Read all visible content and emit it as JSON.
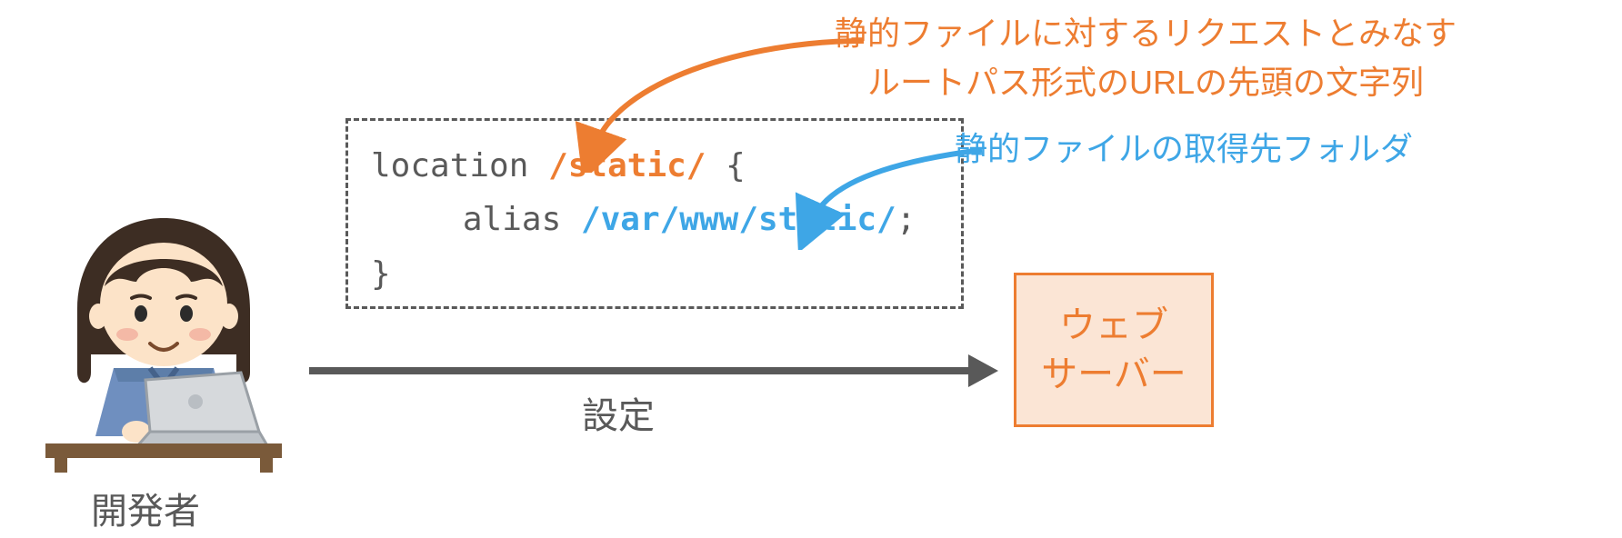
{
  "developer": {
    "label": "開発者"
  },
  "code": {
    "location_keyword": "location",
    "location_path": "/static/",
    "open_brace": "{",
    "alias_keyword": "alias",
    "alias_path": "/var/www/static/",
    "semicolon": ";",
    "close_brace": "}"
  },
  "flow": {
    "label": "設定"
  },
  "server": {
    "line1": "ウェブ",
    "line2": "サーバー"
  },
  "annotation_orange": {
    "line1": "静的ファイルに対するリクエストとみなす",
    "line2": "ルートパス形式のURLの先頭の文字列"
  },
  "annotation_blue": {
    "text": "静的ファイルの取得先フォルダ"
  },
  "colors": {
    "orange": "#ED7D31",
    "blue": "#3EA6E6",
    "gray": "#595959",
    "server_fill": "#FBE5D5"
  }
}
